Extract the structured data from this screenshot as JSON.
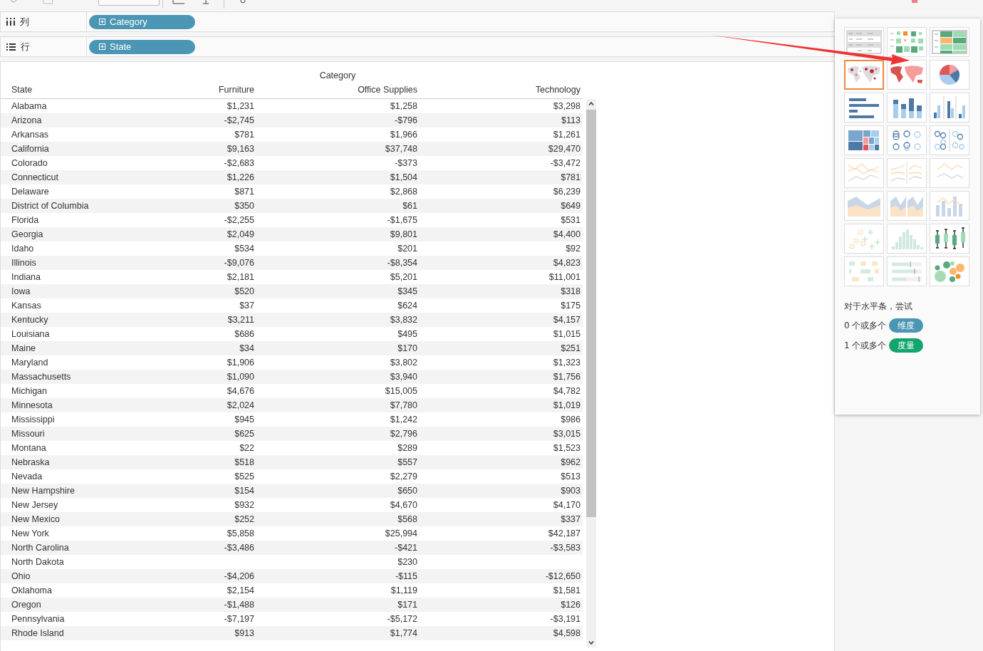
{
  "shelves": [
    {
      "kind": "columns",
      "label": "列",
      "pill": "Category"
    },
    {
      "kind": "rows",
      "label": "行",
      "pill": "State"
    }
  ],
  "table": {
    "column_group": "Category",
    "columns": [
      "State",
      "Furniture",
      "Office Supplies",
      "Technology"
    ],
    "rows": [
      {
        "state": "Alabama",
        "furniture": "$1,231",
        "office_supplies": "$1,258",
        "technology": "$3,298"
      },
      {
        "state": "Arizona",
        "furniture": "-$2,745",
        "office_supplies": "-$796",
        "technology": "$113"
      },
      {
        "state": "Arkansas",
        "furniture": "$781",
        "office_supplies": "$1,966",
        "technology": "$1,261"
      },
      {
        "state": "California",
        "furniture": "$9,163",
        "office_supplies": "$37,748",
        "technology": "$29,470"
      },
      {
        "state": "Colorado",
        "furniture": "-$2,683",
        "office_supplies": "-$373",
        "technology": "-$3,472"
      },
      {
        "state": "Connecticut",
        "furniture": "$1,226",
        "office_supplies": "$1,504",
        "technology": "$781"
      },
      {
        "state": "Delaware",
        "furniture": "$871",
        "office_supplies": "$2,868",
        "technology": "$6,239"
      },
      {
        "state": "District of Columbia",
        "furniture": "$350",
        "office_supplies": "$61",
        "technology": "$649"
      },
      {
        "state": "Florida",
        "furniture": "-$2,255",
        "office_supplies": "-$1,675",
        "technology": "$531"
      },
      {
        "state": "Georgia",
        "furniture": "$2,049",
        "office_supplies": "$9,801",
        "technology": "$4,400"
      },
      {
        "state": "Idaho",
        "furniture": "$534",
        "office_supplies": "$201",
        "technology": "$92"
      },
      {
        "state": "Illinois",
        "furniture": "-$9,076",
        "office_supplies": "-$8,354",
        "technology": "$4,823"
      },
      {
        "state": "Indiana",
        "furniture": "$2,181",
        "office_supplies": "$5,201",
        "technology": "$11,001"
      },
      {
        "state": "Iowa",
        "furniture": "$520",
        "office_supplies": "$345",
        "technology": "$318"
      },
      {
        "state": "Kansas",
        "furniture": "$37",
        "office_supplies": "$624",
        "technology": "$175"
      },
      {
        "state": "Kentucky",
        "furniture": "$3,211",
        "office_supplies": "$3,832",
        "technology": "$4,157"
      },
      {
        "state": "Louisiana",
        "furniture": "$686",
        "office_supplies": "$495",
        "technology": "$1,015"
      },
      {
        "state": "Maine",
        "furniture": "$34",
        "office_supplies": "$170",
        "technology": "$251"
      },
      {
        "state": "Maryland",
        "furniture": "$1,906",
        "office_supplies": "$3,802",
        "technology": "$1,323"
      },
      {
        "state": "Massachusetts",
        "furniture": "$1,090",
        "office_supplies": "$3,940",
        "technology": "$1,756"
      },
      {
        "state": "Michigan",
        "furniture": "$4,676",
        "office_supplies": "$15,005",
        "technology": "$4,782"
      },
      {
        "state": "Minnesota",
        "furniture": "$2,024",
        "office_supplies": "$7,780",
        "technology": "$1,019"
      },
      {
        "state": "Mississippi",
        "furniture": "$945",
        "office_supplies": "$1,242",
        "technology": "$986"
      },
      {
        "state": "Missouri",
        "furniture": "$625",
        "office_supplies": "$2,796",
        "technology": "$3,015"
      },
      {
        "state": "Montana",
        "furniture": "$22",
        "office_supplies": "$289",
        "technology": "$1,523"
      },
      {
        "state": "Nebraska",
        "furniture": "$518",
        "office_supplies": "$557",
        "technology": "$962"
      },
      {
        "state": "Nevada",
        "furniture": "$525",
        "office_supplies": "$2,279",
        "technology": "$513"
      },
      {
        "state": "New Hampshire",
        "furniture": "$154",
        "office_supplies": "$650",
        "technology": "$903"
      },
      {
        "state": "New Jersey",
        "furniture": "$932",
        "office_supplies": "$4,670",
        "technology": "$4,170"
      },
      {
        "state": "New Mexico",
        "furniture": "$252",
        "office_supplies": "$568",
        "technology": "$337"
      },
      {
        "state": "New York",
        "furniture": "$5,858",
        "office_supplies": "$25,994",
        "technology": "$42,187"
      },
      {
        "state": "North Carolina",
        "furniture": "-$3,486",
        "office_supplies": "-$421",
        "technology": "-$3,583"
      },
      {
        "state": "North Dakota",
        "office_supplies": "$230"
      },
      {
        "state": "Ohio",
        "furniture": "-$4,206",
        "office_supplies": "-$115",
        "technology": "-$12,650"
      },
      {
        "state": "Oklahoma",
        "furniture": "$2,154",
        "office_supplies": "$1,119",
        "technology": "$1,581"
      },
      {
        "state": "Oregon",
        "furniture": "-$1,488",
        "office_supplies": "$171",
        "technology": "$126"
      },
      {
        "state": "Pennsylvania",
        "furniture": "-$7,197",
        "office_supplies": "-$5,172",
        "technology": "-$3,191"
      },
      {
        "state": "Rhode Island",
        "furniture": "$913",
        "office_supplies": "$1,774",
        "technology": "$4,598"
      }
    ]
  },
  "show_me": {
    "charts": [
      {
        "kind": "text-table",
        "selected": false
      },
      {
        "kind": "heat-map",
        "selected": false
      },
      {
        "kind": "highlight-table",
        "selected": false
      },
      {
        "kind": "symbol-map",
        "selected": true
      },
      {
        "kind": "filled-map",
        "selected": false
      },
      {
        "kind": "pie",
        "selected": false
      },
      {
        "kind": "horizontal-bars",
        "selected": false
      },
      {
        "kind": "stacked-bars",
        "selected": false
      },
      {
        "kind": "side-by-side-bars",
        "selected": false
      },
      {
        "kind": "treemap",
        "selected": false
      },
      {
        "kind": "circle-views",
        "selected": false
      },
      {
        "kind": "side-by-side-circles",
        "selected": false
      },
      {
        "kind": "lines-continuous",
        "selected": false
      },
      {
        "kind": "lines-discrete",
        "selected": false
      },
      {
        "kind": "dual-lines",
        "selected": false
      },
      {
        "kind": "area-continuous",
        "selected": false
      },
      {
        "kind": "area-discrete",
        "selected": false
      },
      {
        "kind": "dual-combination",
        "selected": false
      },
      {
        "kind": "scatter",
        "selected": false
      },
      {
        "kind": "histogram",
        "selected": false
      },
      {
        "kind": "box-whisker",
        "selected": false
      },
      {
        "kind": "gantt",
        "selected": false
      },
      {
        "kind": "bullet",
        "selected": false
      },
      {
        "kind": "packed-bubbles",
        "selected": false
      }
    ],
    "hint": "对于水平条，尝试",
    "requirements": [
      {
        "text": "0 个或多个",
        "pill": "维度",
        "kind": "dimension"
      },
      {
        "text": "1 个或多个",
        "pill": "度量",
        "kind": "measure"
      }
    ]
  }
}
